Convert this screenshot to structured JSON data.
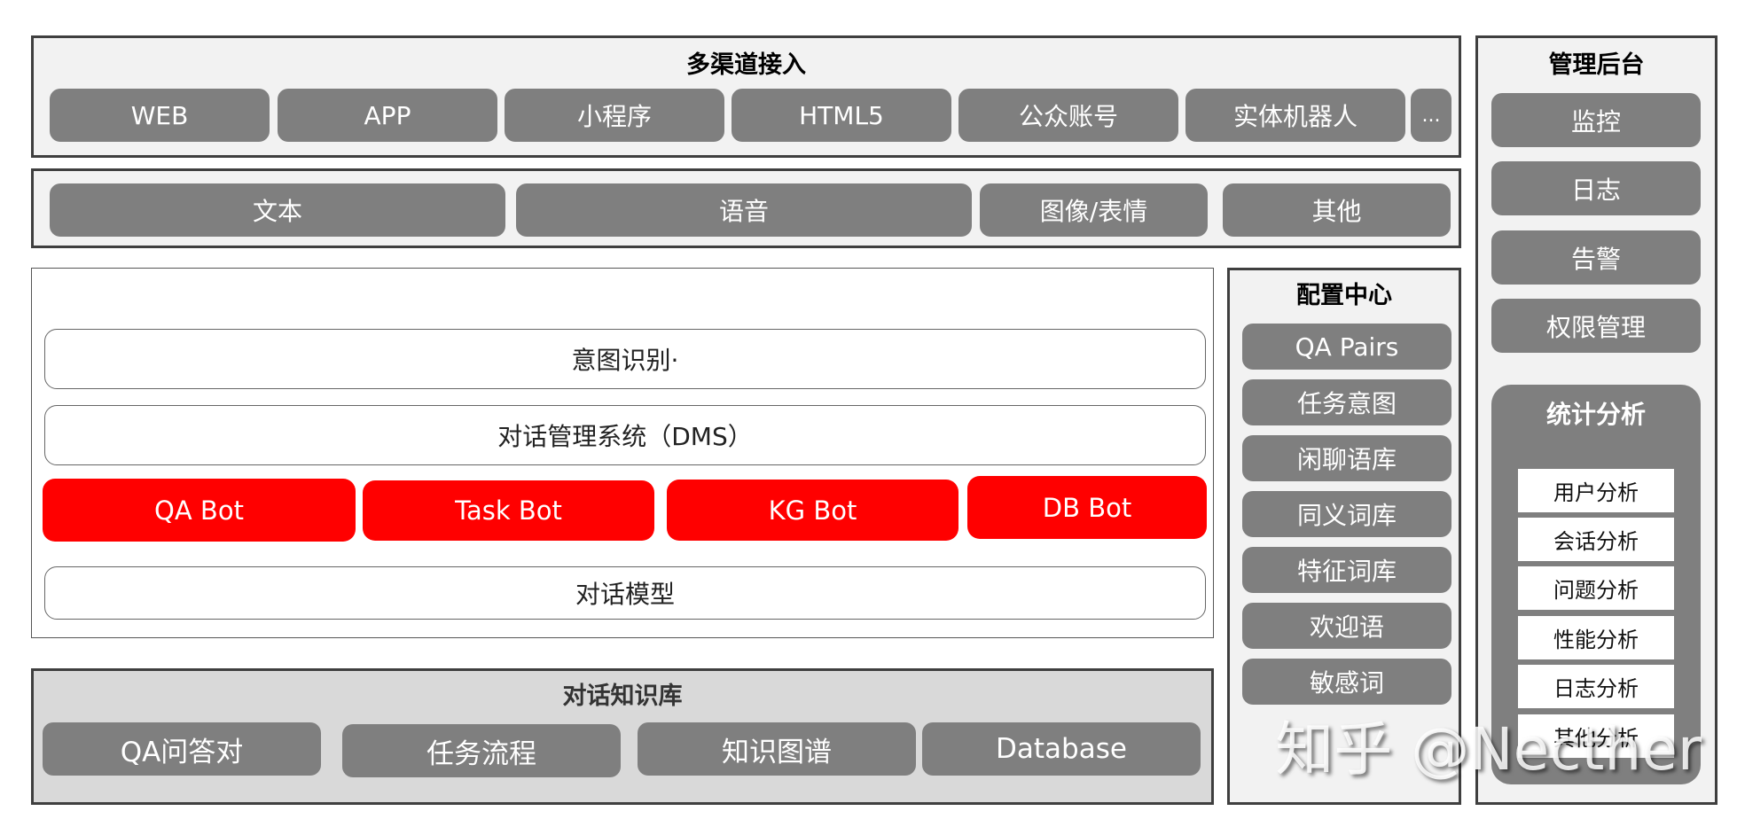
{
  "channels": {
    "title": "多渠道接入",
    "items": [
      "WEB",
      "APP",
      "小程序",
      "HTML5",
      "公众账号",
      "实体机器人",
      "..."
    ]
  },
  "modalities": {
    "items": [
      "文本",
      "语音",
      "图像/表情",
      "其他"
    ]
  },
  "core": {
    "intent": "意图识别·",
    "dms": "对话管理系统（DMS）",
    "bots": [
      "QA Bot",
      "Task Bot",
      "KG Bot",
      "DB Bot"
    ],
    "model": "对话模型"
  },
  "knowledge": {
    "title": "对话知识库",
    "items": [
      "QA问答对",
      "任务流程",
      "知识图谱",
      "Database"
    ]
  },
  "config": {
    "title": "配置中心",
    "items": [
      "QA Pairs",
      "任务意图",
      "闲聊语库",
      "同义词库",
      "特征词库",
      "欢迎语",
      "敏感词"
    ]
  },
  "admin": {
    "title": "管理后台",
    "items": [
      "监控",
      "日志",
      "告警",
      "权限管理"
    ],
    "stats": {
      "title": "统计分析",
      "items": [
        "用户分析",
        "会话分析",
        "问题分析",
        "性能分析",
        "日志分析",
        "其他分析"
      ]
    }
  },
  "colors": {
    "pill": "#7f7f7f",
    "bot": "#ff0000",
    "panel": "#f2f2f2",
    "knowledge_panel": "#d9d9d9"
  },
  "watermark": "知乎 @Necther"
}
